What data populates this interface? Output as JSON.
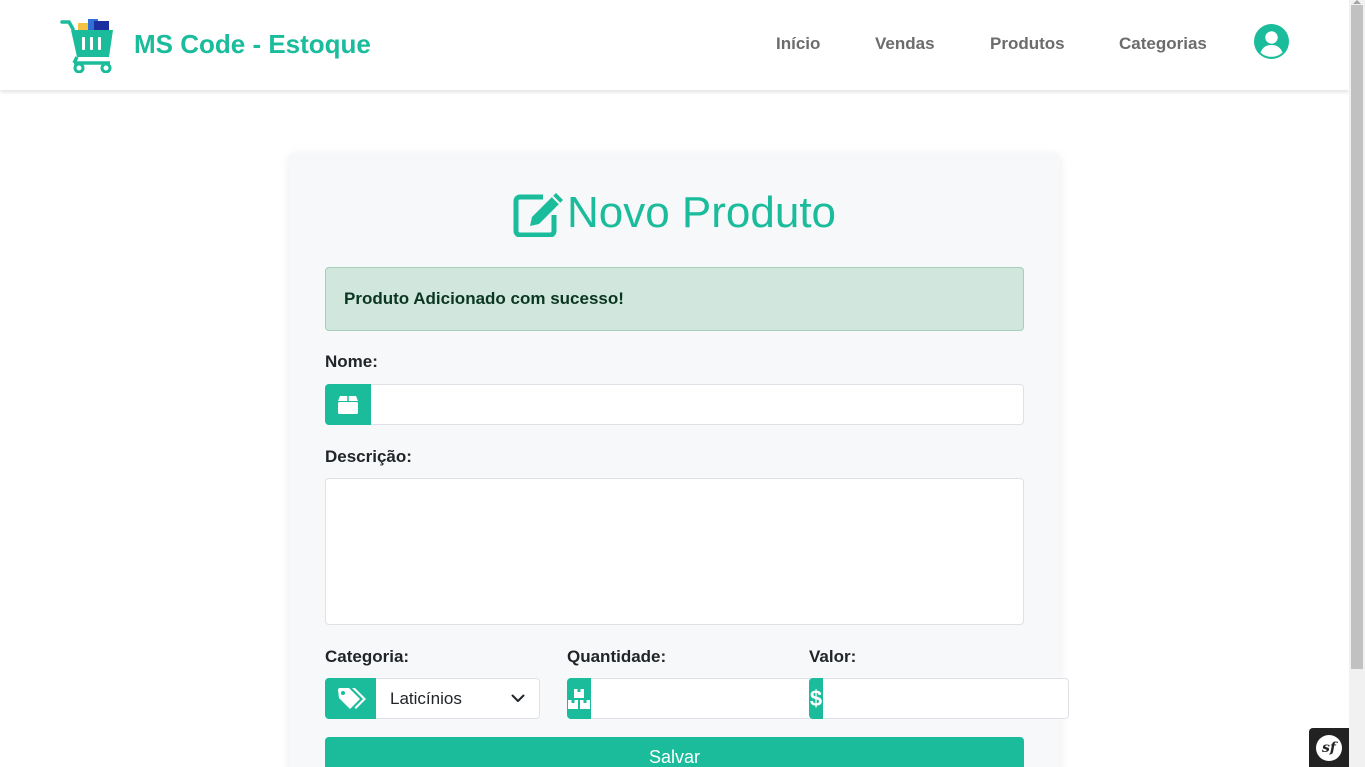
{
  "brand": {
    "title": "MS Code - Estoque",
    "logo_icon": "shopping-cart-icon"
  },
  "nav": {
    "items": [
      {
        "label": "Início"
      },
      {
        "label": "Vendas"
      },
      {
        "label": "Produtos"
      },
      {
        "label": "Categorias"
      }
    ],
    "user_icon": "user-circle-icon"
  },
  "form": {
    "title": "Novo Produto",
    "title_icon": "edit-icon",
    "alert": "Produto Adicionado com sucesso!",
    "nome": {
      "label": "Nome:",
      "value": "",
      "icon": "box-icon"
    },
    "descricao": {
      "label": "Descrição:",
      "value": ""
    },
    "categoria": {
      "label": "Categoria:",
      "selected": "Laticínios",
      "icon": "tags-icon"
    },
    "quantidade": {
      "label": "Quantidade:",
      "value": "",
      "icon": "boxes-icon"
    },
    "valor": {
      "label": "Valor:",
      "value": "",
      "icon": "dollar-icon"
    },
    "submit_label": "Salvar"
  },
  "debug_toolbar": {
    "label": "sf"
  },
  "colors": {
    "accent": "#1abc9c",
    "alert_bg": "#d1e7dd",
    "alert_text": "#0a3622",
    "nav_text": "#6c6c6c"
  }
}
